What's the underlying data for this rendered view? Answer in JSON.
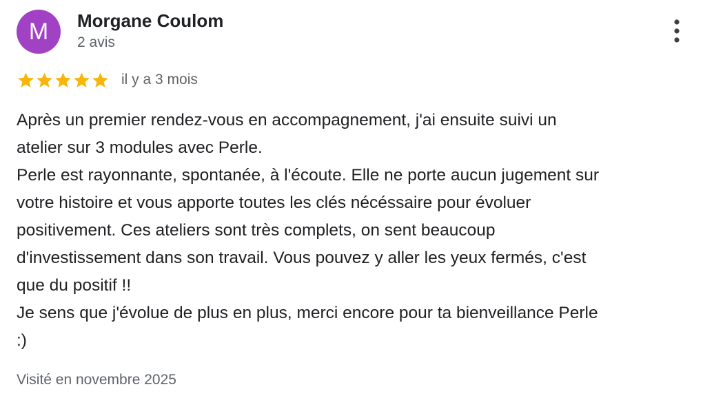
{
  "review": {
    "author": {
      "initial": "M",
      "name": "Morgane Coulom",
      "review_count": "2 avis",
      "avatar_color": "#a142c4"
    },
    "menu_icon": "more-vert-icon",
    "rating": {
      "stars": 5,
      "max": 5,
      "star_color": "#f8b60b",
      "date": "il y a 3 mois"
    },
    "text_lines": [
      "Après un premier rendez-vous en accompagnement, j'ai ensuite suivi un",
      "atelier sur 3 modules avec Perle.",
      "Perle est rayonnante, spontanée, à l'écoute. Elle ne porte aucun jugement sur",
      "votre histoire et vous apporte toutes les clés nécéssaire pour évoluer",
      "positivement. Ces ateliers sont très complets, on sent beaucoup",
      "d'investissement dans son travail. Vous pouvez y aller les yeux fermés, c'est",
      "que du positif !!",
      "Je sens que j'évolue de plus en plus, merci encore pour ta bienveillance Perle",
      ":)"
    ],
    "visit_info": "Visité en novembre 2025"
  }
}
